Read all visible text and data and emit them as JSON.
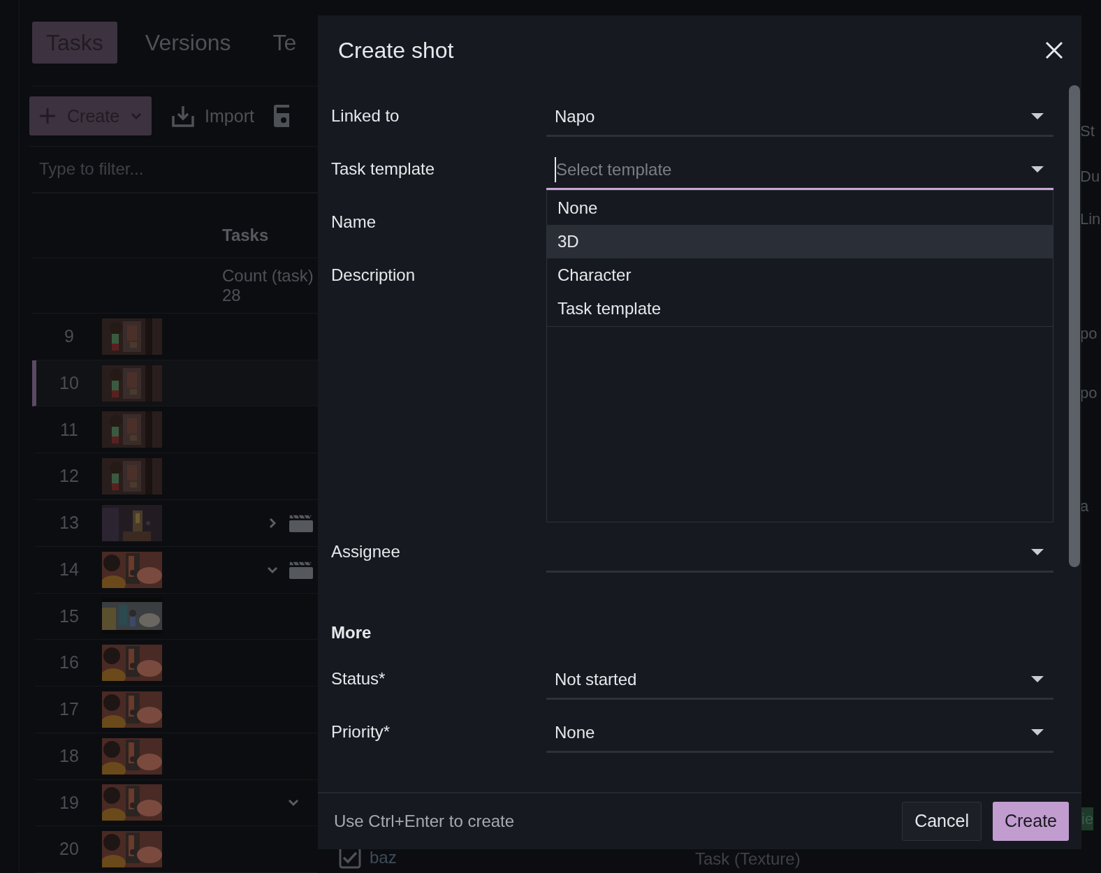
{
  "background": {
    "tabs": [
      {
        "label": "Tasks",
        "selected": true
      },
      {
        "label": "Versions",
        "selected": false
      },
      {
        "label": "Te",
        "selected": false
      }
    ],
    "toolbar": {
      "create": "Create",
      "import": "Import"
    },
    "filter": {
      "placeholder": "Type to filter..."
    },
    "column_header": "Tasks",
    "count_label": "Count (task)",
    "count": "28",
    "rows": [
      {
        "number": "9",
        "selected": false,
        "kind": "shot"
      },
      {
        "number": "10",
        "selected": true,
        "kind": "shot"
      },
      {
        "number": "11",
        "selected": false,
        "kind": "shot"
      },
      {
        "number": "12",
        "selected": false,
        "kind": "shot"
      },
      {
        "number": "13",
        "selected": false,
        "kind": "collapsed"
      },
      {
        "number": "14",
        "selected": false,
        "kind": "expanded"
      },
      {
        "number": "15",
        "selected": false,
        "kind": "shot"
      },
      {
        "number": "16",
        "selected": false,
        "kind": "shot"
      },
      {
        "number": "17",
        "selected": false,
        "kind": "shot"
      },
      {
        "number": "18",
        "selected": false,
        "kind": "shot"
      },
      {
        "number": "19",
        "selected": false,
        "kind": "subgroup"
      },
      {
        "number": "20",
        "selected": false,
        "kind": "shot"
      }
    ],
    "bottom_item": {
      "checked": true,
      "name": "baz",
      "type": "Task (Texture)"
    },
    "right_edge": [
      "St",
      "Du",
      "Lin",
      "po",
      "po",
      "a",
      "ie"
    ]
  },
  "dialog": {
    "title": "Create shot",
    "fields": [
      {
        "label": "Linked to",
        "kind": "select",
        "value": "Napo",
        "focused": false
      },
      {
        "label": "Task template",
        "kind": "select",
        "placeholder": "Select template",
        "focused": true,
        "options": [
          {
            "label": "None",
            "selected": false
          },
          {
            "label": "3D",
            "selected": true
          },
          {
            "label": "Character",
            "selected": false
          },
          {
            "label": "Task template",
            "selected": false
          }
        ]
      },
      {
        "label": "Name",
        "kind": "text"
      },
      {
        "label": "Description",
        "kind": "textarea"
      },
      {
        "label": "Assignee",
        "kind": "select",
        "focused": false
      }
    ],
    "section": "More",
    "more_fields": [
      {
        "label": "Status*",
        "kind": "select",
        "value": "Not started",
        "focused": false
      },
      {
        "label": "Priority*",
        "kind": "select",
        "value": "None",
        "focused": false
      }
    ],
    "hint": "Use Ctrl+Enter to create",
    "buttons": [
      {
        "label": "Cancel",
        "kind": "secondary"
      },
      {
        "label": "Create",
        "kind": "primary"
      }
    ]
  }
}
